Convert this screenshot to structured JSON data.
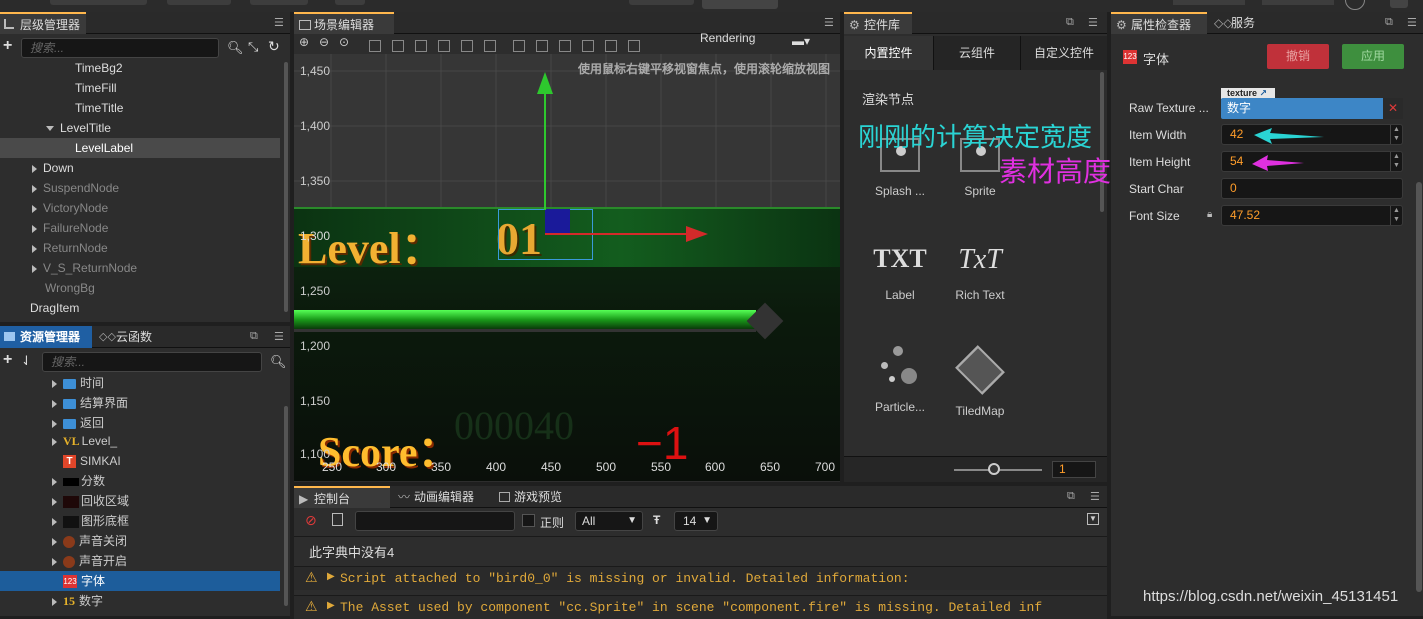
{
  "hierarchy": {
    "title": "层级管理器",
    "search_placeholder": "搜索...",
    "items": [
      {
        "label": "TimeBg2"
      },
      {
        "label": "TimeFill"
      },
      {
        "label": "TimeTitle"
      },
      {
        "label": "LevelTitle"
      },
      {
        "label": "LevelLabel"
      },
      {
        "label": "Down"
      },
      {
        "label": "SuspendNode"
      },
      {
        "label": "VictoryNode"
      },
      {
        "label": "FailureNode"
      },
      {
        "label": "ReturnNode"
      },
      {
        "label": "V_S_ReturnNode"
      },
      {
        "label": "WrongBg"
      },
      {
        "label": "DragItem"
      }
    ]
  },
  "assets": {
    "title": "资源管理器",
    "tab2": "云函数",
    "search_placeholder": "搜索...",
    "items": [
      {
        "label": "时间"
      },
      {
        "label": "结算界面"
      },
      {
        "label": "返回"
      },
      {
        "label": "Level_",
        "icon_text": "VL"
      },
      {
        "label": "SIMKAI"
      },
      {
        "label": "分数"
      },
      {
        "label": "回收区域"
      },
      {
        "label": "图形底框"
      },
      {
        "label": "声音关闭"
      },
      {
        "label": "声音开启"
      },
      {
        "label": "字体"
      },
      {
        "label": "数字",
        "icon_text": "15"
      }
    ]
  },
  "scene": {
    "title": "场景编辑器",
    "rendering": "Rendering",
    "hint": "使用鼠标右键平移视窗焦点，使用滚轮缩放视图",
    "y_ticks": [
      "1,450",
      "1,400",
      "1,350",
      "1,300",
      "1,250",
      "1,200",
      "1,150",
      "1,100"
    ],
    "x_ticks": [
      "250",
      "300",
      "350",
      "400",
      "450",
      "500",
      "550",
      "600",
      "650",
      "700"
    ],
    "level_text": "Level：",
    "level_num": "01",
    "score_text": "Score：",
    "score_num": "000040",
    "minus": "−1"
  },
  "library": {
    "title": "控件库",
    "tabs": [
      "内置控件",
      "云组件",
      "自定义控件"
    ],
    "section": "渲染节点",
    "items": [
      {
        "label": "Splash ..."
      },
      {
        "label": "Sprite"
      },
      {
        "label": "Label",
        "glyph": "TXT"
      },
      {
        "label": "Rich Text",
        "glyph": "TxT"
      },
      {
        "label": "Particle..."
      },
      {
        "label": "TiledMap"
      }
    ],
    "zoom_value": "1"
  },
  "console": {
    "tabs": [
      "控制台",
      "动画编辑器",
      "游戏预览"
    ],
    "regex_label": "正则",
    "filter_value": "All",
    "font_size_value": "14",
    "lines": [
      "此字典中没有4",
      "Script attached to \"bird0_0\" is missing or invalid. Detailed information:",
      "The Asset used by component \"cc.Sprite\" in scene \"component.fire\" is missing. Detailed inf"
    ]
  },
  "inspector": {
    "title": "属性检查器",
    "tab2": "服务",
    "component": "字体",
    "component_icon": "123",
    "revert_label": "撤销",
    "apply_label": "应用",
    "texture_tag": "texture",
    "props": [
      {
        "label": "Raw Texture ...",
        "value": "数字"
      },
      {
        "label": "Item Width",
        "value": "42"
      },
      {
        "label": "Item Height",
        "value": "54"
      },
      {
        "label": "Start Char",
        "value": "0"
      },
      {
        "label": "Font Size",
        "value": "47.52"
      }
    ],
    "annotation_width": "刚刚的计算决定宽度",
    "annotation_height": "素材高度",
    "annotation_width_color": "#2ad4d4",
    "annotation_height_color": "#e030e0"
  },
  "watermark": "https://blog.csdn.net/weixin_45131451"
}
